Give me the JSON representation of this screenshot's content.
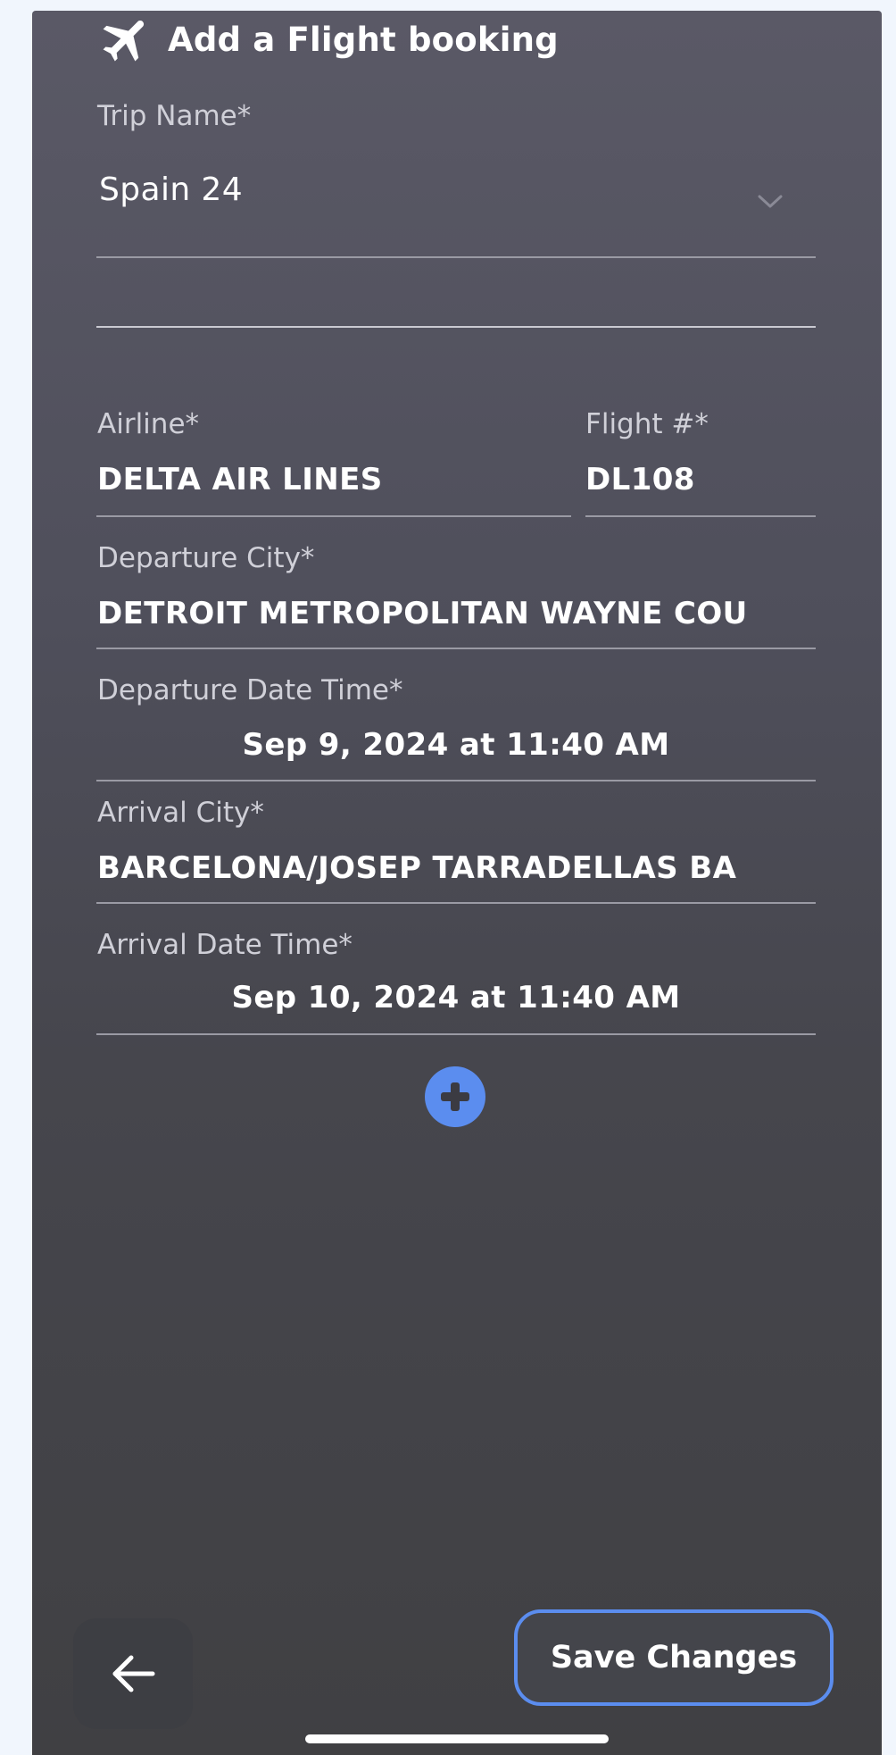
{
  "header": {
    "title": "Add a Flight booking",
    "icon": "airplane-icon"
  },
  "form": {
    "trip_name": {
      "label": "Trip Name*",
      "value": "Spain 24"
    },
    "airline": {
      "label": "Airline*",
      "value": "DELTA AIR LINES"
    },
    "flight_number": {
      "label": "Flight #*",
      "value": "DL108"
    },
    "departure_city": {
      "label": "Departure City*",
      "value": "DETROIT METROPOLITAN WAYNE COU"
    },
    "departure_datetime": {
      "label": "Departure Date Time*",
      "value": "Sep 9, 2024 at 11:40 AM"
    },
    "arrival_city": {
      "label": "Arrival City*",
      "value": "BARCELONA/JOSEP TARRADELLAS BA"
    },
    "arrival_datetime": {
      "label": "Arrival Date Time*",
      "value": "Sep 10, 2024 at 11:40 AM"
    }
  },
  "actions": {
    "add_icon": "plus-circle-icon",
    "back_icon": "arrow-left-icon",
    "save_label": "Save Changes"
  },
  "colors": {
    "accent": "#5b8def",
    "background_top": "#5a5966",
    "background_bottom": "#404043",
    "text": "#ffffff",
    "label": "#d0d0d8"
  }
}
